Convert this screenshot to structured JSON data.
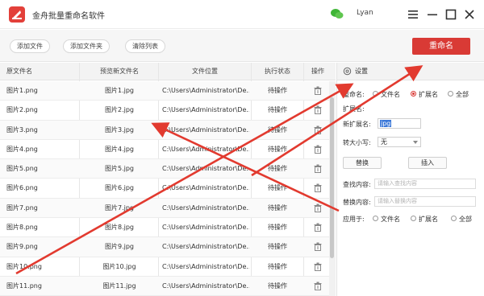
{
  "app": {
    "title": "金舟批量重命名软件",
    "username": "Lyan"
  },
  "toolbar": {
    "add_file": "添加文件",
    "add_folder": "添加文件夹",
    "clear_list": "清除列表",
    "rename": "重命名"
  },
  "table": {
    "headers": [
      "原文件名",
      "预览新文件名",
      "文件位置",
      "执行状态",
      "操作"
    ],
    "rows": [
      {
        "orig": "图片1.png",
        "new": "图片1.jpg",
        "loc": "C:\\Users\\Administrator\\De...",
        "status": "待操作"
      },
      {
        "orig": "图片2.png",
        "new": "图片2.jpg",
        "loc": "C:\\Users\\Administrator\\De...",
        "status": "待操作"
      },
      {
        "orig": "图片3.png",
        "new": "图片3.jpg",
        "loc": "C:\\Users\\Administrator\\De...",
        "status": "待操作"
      },
      {
        "orig": "图片4.png",
        "new": "图片4.jpg",
        "loc": "C:\\Users\\Administrator\\De...",
        "status": "待操作"
      },
      {
        "orig": "图片5.png",
        "new": "图片5.jpg",
        "loc": "C:\\Users\\Administrator\\De...",
        "status": "待操作"
      },
      {
        "orig": "图片6.png",
        "new": "图片6.jpg",
        "loc": "C:\\Users\\Administrator\\De...",
        "status": "待操作"
      },
      {
        "orig": "图片7.png",
        "new": "图片7.jpg",
        "loc": "C:\\Users\\Administrator\\De...",
        "status": "待操作"
      },
      {
        "orig": "图片8.png",
        "new": "图片8.jpg",
        "loc": "C:\\Users\\Administrator\\De...",
        "status": "待操作"
      },
      {
        "orig": "图片9.png",
        "new": "图片9.jpg",
        "loc": "C:\\Users\\Administrator\\De...",
        "status": "待操作"
      },
      {
        "orig": "图片10.png",
        "new": "图片10.jpg",
        "loc": "C:\\Users\\Administrator\\De...",
        "status": "待操作"
      },
      {
        "orig": "图片11.png",
        "new": "图片11.jpg",
        "loc": "C:\\Users\\Administrator\\De...",
        "status": "待操作"
      }
    ]
  },
  "settings": {
    "title": "设置",
    "rename_label": "重命名:",
    "rename_options": [
      "文件名",
      "扩展名",
      "全部"
    ],
    "rename_selected": "扩展名",
    "ext_label": "扩展名:",
    "new_ext_label": "新扩展名:",
    "new_ext_value": "jpg",
    "case_label": "转大小写:",
    "case_value": "无",
    "replace_btn": "替换",
    "insert_btn": "插入",
    "find_label": "查找内容:",
    "find_placeholder": "请输入查找内容",
    "replace_label": "替换内容:",
    "replace_placeholder": "请输入替换内容",
    "apply_label": "应用于:",
    "apply_options": [
      "文件名",
      "扩展名",
      "全部"
    ]
  },
  "colors": {
    "accent": "#d93a35",
    "arrow": "#e23a2f"
  },
  "icons": [
    "app-logo-icon",
    "wechat-icon",
    "menu-icon",
    "minimize-icon",
    "maximize-icon",
    "close-icon",
    "trash-icon",
    "gear-icon"
  ]
}
